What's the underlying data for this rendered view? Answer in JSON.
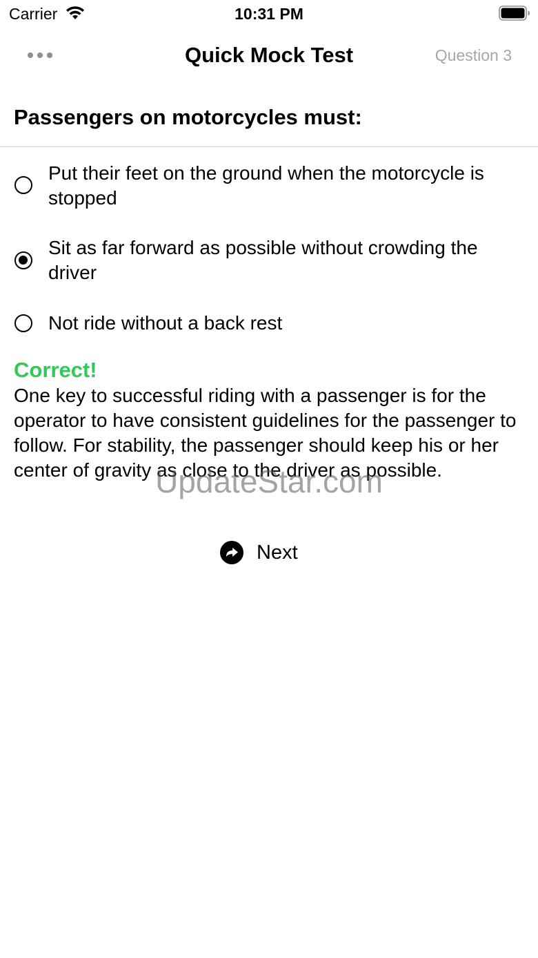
{
  "status_bar": {
    "carrier": "Carrier",
    "time": "10:31 PM",
    "wifi_icon": "wifi-icon",
    "battery_icon": "battery-icon"
  },
  "nav": {
    "more_icon": "ellipsis-icon",
    "title": "Quick Mock Test",
    "question_label": "Question 3"
  },
  "question": {
    "text": "Passengers on motorcycles must:"
  },
  "options": [
    {
      "label": "Put their feet on the ground when the motorcycle is stopped",
      "selected": false
    },
    {
      "label": "Sit as far forward as possible without crowding the driver",
      "selected": true
    },
    {
      "label": "Not ride without a back rest",
      "selected": false
    }
  ],
  "feedback": {
    "title": "Correct!",
    "title_color": "#34c759",
    "explanation": "One key to successful riding with a passenger is for the operator to have consistent guidelines for the passenger to follow. For stability, the passenger should keep his or her center of gravity as close to the driver as possible."
  },
  "watermark": "UpdateStar.com",
  "next_button": {
    "label": "Next",
    "icon": "arrow-circle-right-icon"
  }
}
